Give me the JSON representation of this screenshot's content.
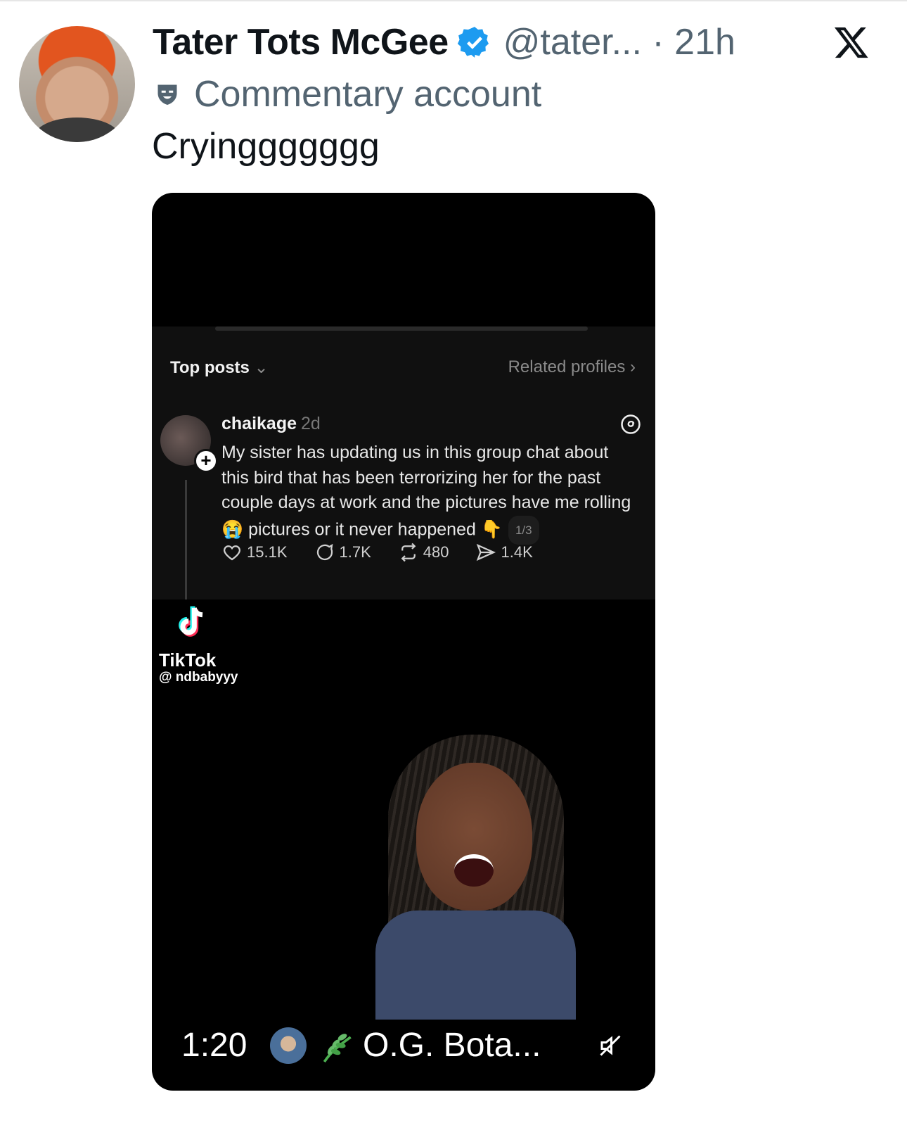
{
  "tweet": {
    "display_name": "Tater Tots McGee",
    "handle_time": "@tater... · 21h",
    "label": "Commentary account",
    "text": "Cryinggggggg",
    "icons": {
      "verified": "verified-badge-icon",
      "label": "mask-icon",
      "logo": "x-logo-icon"
    }
  },
  "media": {
    "threads": {
      "tab": "Top posts",
      "related": "Related profiles ›",
      "username": "chaikage",
      "time": "2d",
      "body_part1": "My sister has updating us in this group chat about this bird that has been terrorizing her for the past couple days at work and the pictures have me rolling 😭 pictures or it never happened 👇",
      "pager": "1/3",
      "likes": "15.1K",
      "replies": "1.7K",
      "reposts": "480",
      "shares": "1.4K"
    },
    "tiktok": {
      "brand": "TikTok",
      "user": "@ ndbabyyy"
    },
    "duration": "1:20",
    "channel": "O.G. Bota...",
    "icons": {
      "mute": "mute-icon",
      "plant": "herb-icon"
    }
  },
  "colors": {
    "text": "#0f1419",
    "secondary": "#536471",
    "verified": "#1d9bf0"
  }
}
